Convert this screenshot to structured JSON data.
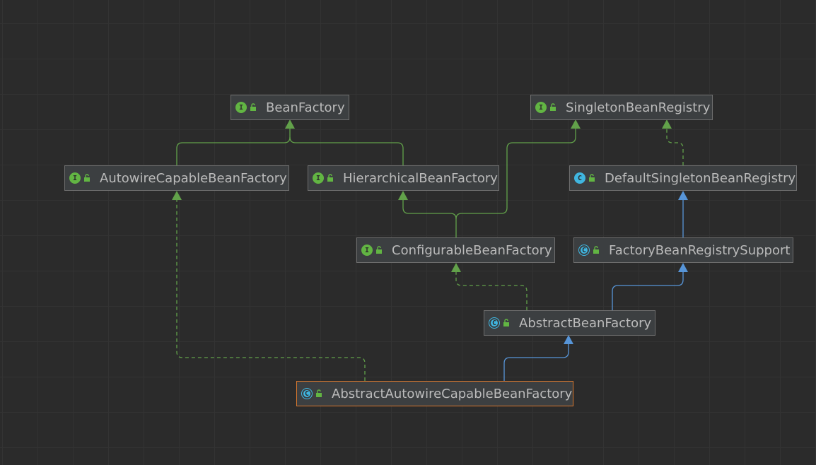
{
  "diagram": {
    "nodes": [
      {
        "id": "bean-factory",
        "name": "BeanFactory",
        "kind": "interface",
        "kind_letter": "I"
      },
      {
        "id": "singleton-bean-registry",
        "name": "SingletonBeanRegistry",
        "kind": "interface",
        "kind_letter": "I"
      },
      {
        "id": "autowire-capable-bean-factory",
        "name": "AutowireCapableBeanFactory",
        "kind": "interface",
        "kind_letter": "I"
      },
      {
        "id": "hierarchical-bean-factory",
        "name": "HierarchicalBeanFactory",
        "kind": "interface",
        "kind_letter": "I"
      },
      {
        "id": "default-singleton-bean-registry",
        "name": "DefaultSingletonBeanRegistry",
        "kind": "class",
        "kind_letter": "C"
      },
      {
        "id": "configurable-bean-factory",
        "name": "ConfigurableBeanFactory",
        "kind": "interface",
        "kind_letter": "I"
      },
      {
        "id": "factory-bean-registry-support",
        "name": "FactoryBeanRegistrySupport",
        "kind": "abstract",
        "kind_letter": "C"
      },
      {
        "id": "abstract-bean-factory",
        "name": "AbstractBeanFactory",
        "kind": "abstract",
        "kind_letter": "C"
      },
      {
        "id": "abstract-autowire-capable-bean-factory",
        "name": "AbstractAutowireCapableBeanFactory",
        "kind": "abstract",
        "kind_letter": "C",
        "selected": true
      }
    ],
    "edges": [
      {
        "from": "autowire-capable-bean-factory",
        "to": "bean-factory",
        "type": "extends"
      },
      {
        "from": "hierarchical-bean-factory",
        "to": "bean-factory",
        "type": "extends"
      },
      {
        "from": "configurable-bean-factory",
        "to": "hierarchical-bean-factory",
        "type": "extends"
      },
      {
        "from": "configurable-bean-factory",
        "to": "singleton-bean-registry",
        "type": "extends"
      },
      {
        "from": "default-singleton-bean-registry",
        "to": "singleton-bean-registry",
        "type": "implements"
      },
      {
        "from": "factory-bean-registry-support",
        "to": "default-singleton-bean-registry",
        "type": "class-extends"
      },
      {
        "from": "abstract-bean-factory",
        "to": "factory-bean-registry-support",
        "type": "class-extends"
      },
      {
        "from": "abstract-bean-factory",
        "to": "configurable-bean-factory",
        "type": "implements"
      },
      {
        "from": "abstract-autowire-capable-bean-factory",
        "to": "abstract-bean-factory",
        "type": "class-extends"
      },
      {
        "from": "abstract-autowire-capable-bean-factory",
        "to": "autowire-capable-bean-factory",
        "type": "implements"
      }
    ]
  },
  "colors": {
    "background": "#2b2b2b",
    "interface_edge": "#62a14a",
    "class_edge": "#5795d8",
    "selected_border": "#d8772e",
    "interface_icon": "#62b543",
    "class_icon": "#40b6e0"
  }
}
